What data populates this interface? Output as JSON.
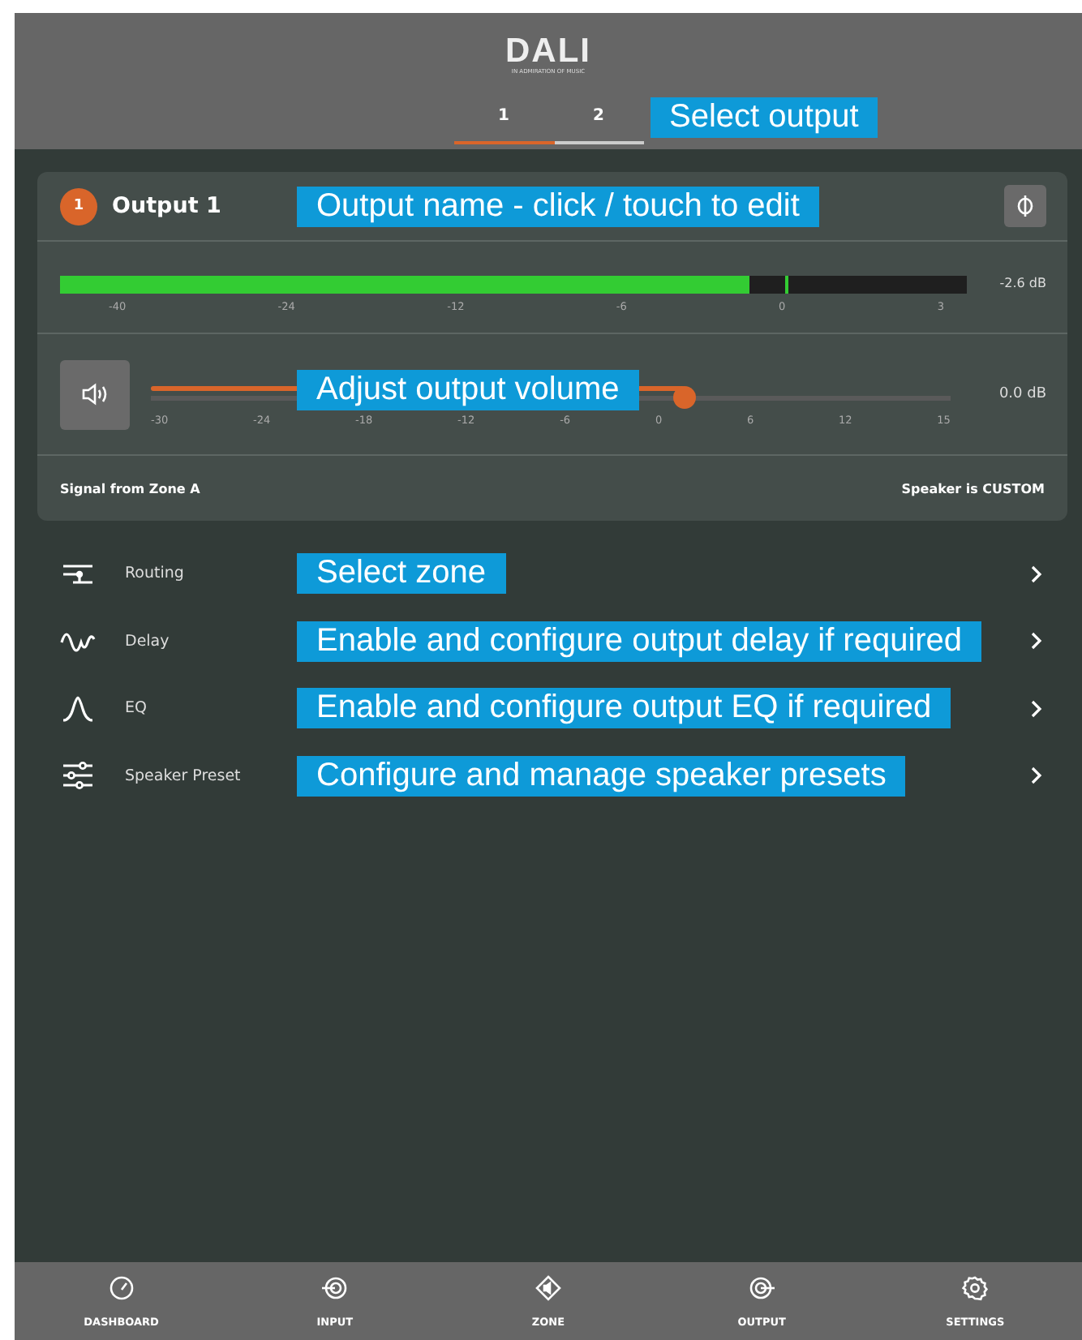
{
  "header": {
    "logo": "DALI",
    "tagline": "IN ADMIRATION OF MUSIC",
    "tabs": [
      {
        "label": "1",
        "selected": true
      },
      {
        "label": "2",
        "selected": false
      }
    ],
    "callout": "Select output"
  },
  "output_card": {
    "badge": "1",
    "name": "Output 1",
    "name_callout": "Output name - click / touch to edit",
    "meter": {
      "level": 0.76,
      "peak_hold": {
        "level": 0.8
      },
      "reading": "-2.6 dB",
      "scale": [
        "-40",
        "-24",
        "-12",
        "-6",
        "0",
        "3"
      ]
    },
    "volume": {
      "level": 0.667,
      "reading": "0.0 dB",
      "callout": "Adjust output volume",
      "scale": [
        "-30",
        "-24",
        "-18",
        "-12",
        "-6",
        "0",
        "6",
        "12",
        "15"
      ]
    },
    "signal": "Signal from Zone A",
    "speaker": "Speaker is CUSTOM"
  },
  "menu": [
    {
      "kind": "routing",
      "label": "Routing",
      "callout": "Select zone"
    },
    {
      "kind": "delay",
      "label": "Delay",
      "callout": "Enable and configure output delay if required"
    },
    {
      "kind": "eq",
      "label": "EQ",
      "callout": "Enable and configure output EQ if required"
    },
    {
      "kind": "preset",
      "label": "Speaker Preset",
      "callout": "Configure and manage speaker presets"
    }
  ],
  "nav": [
    {
      "kind": "dashboard",
      "label": "DASHBOARD"
    },
    {
      "kind": "input",
      "label": "INPUT"
    },
    {
      "kind": "zone",
      "label": "ZONE"
    },
    {
      "kind": "output",
      "label": "OUTPUT"
    },
    {
      "kind": "settings",
      "label": "SETTINGS"
    }
  ]
}
